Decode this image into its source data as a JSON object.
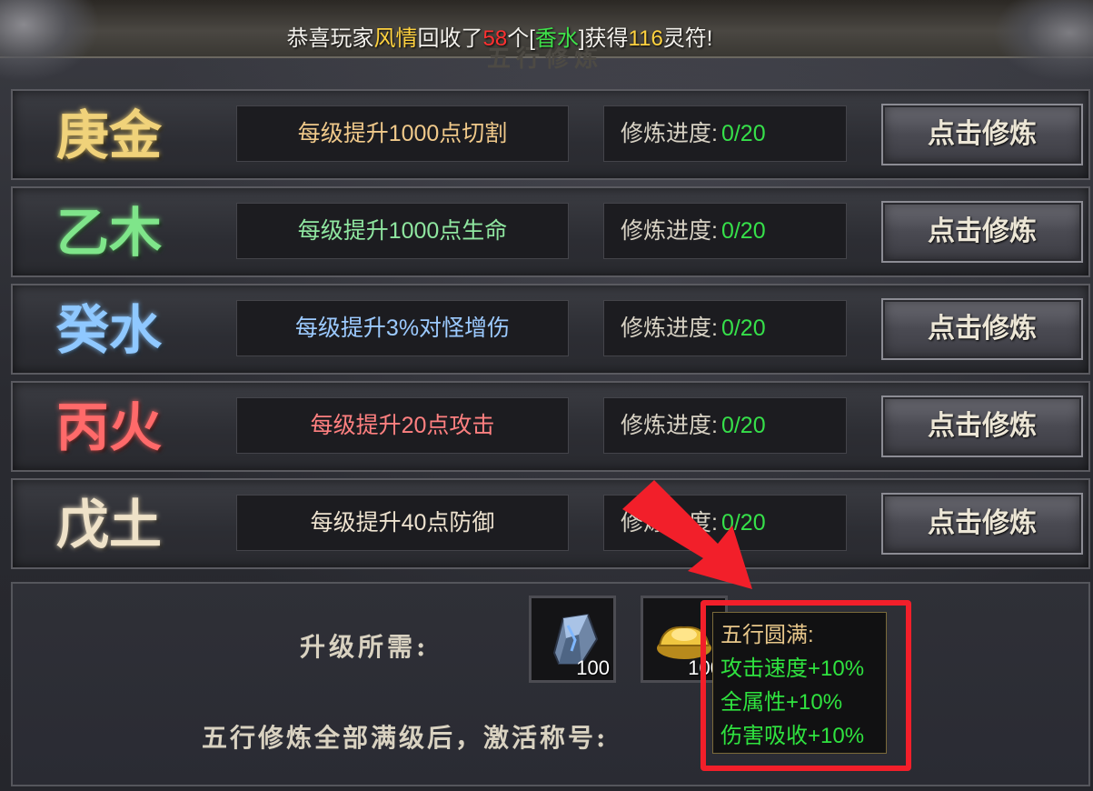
{
  "notice": {
    "prefix": "恭喜玩家",
    "player": "风情",
    "mid1": "回收了",
    "count": "58",
    "mid2": "个[",
    "item": "香水",
    "mid3": "]获得",
    "reward": "116",
    "suffix": "灵符!"
  },
  "panel_title": "五行修炼",
  "rows": [
    {
      "element": "庚金",
      "element_color": "#f0d27a",
      "desc": "每级提升1000点切割",
      "desc_color": "#f0c98a",
      "progress_label": "修炼进度:",
      "progress_value": "0/20",
      "button": "点击修炼"
    },
    {
      "element": "乙木",
      "element_color": "#7fe58a",
      "desc": "每级提升1000点生命",
      "desc_color": "#8fe6a0",
      "progress_label": "修炼进度:",
      "progress_value": "0/20",
      "button": "点击修炼"
    },
    {
      "element": "癸水",
      "element_color": "#8fc8ff",
      "desc": "每级提升3%对怪增伤",
      "desc_color": "#9ccaff",
      "progress_label": "修炼进度:",
      "progress_value": "0/20",
      "button": "点击修炼"
    },
    {
      "element": "丙火",
      "element_color": "#ff6a6a",
      "desc": "每级提升20点攻击",
      "desc_color": "#ff8080",
      "progress_label": "修炼进度:",
      "progress_value": "0/20",
      "button": "点击修炼"
    },
    {
      "element": "戊土",
      "element_color": "#efe2c8",
      "desc": "每级提升40点防御",
      "desc_color": "#ede2cf",
      "progress_label": "修炼进度:",
      "progress_value": "0/20",
      "button": "点击修炼"
    }
  ],
  "upgrade": {
    "label": "升级所需:",
    "items": [
      {
        "icon": "crystal-ore-icon",
        "qty": "100"
      },
      {
        "icon": "gold-ingot-icon",
        "qty": "100"
      }
    ]
  },
  "footer": "五行修炼全部满级后，激活称号:",
  "tooltip": {
    "title": "五行圆满:",
    "lines": [
      "攻击速度+10%",
      "全属性+10%",
      "伤害吸收+10%"
    ]
  },
  "colors": {
    "highlight": "#f21f2a",
    "progress_value": "#36e04a"
  }
}
